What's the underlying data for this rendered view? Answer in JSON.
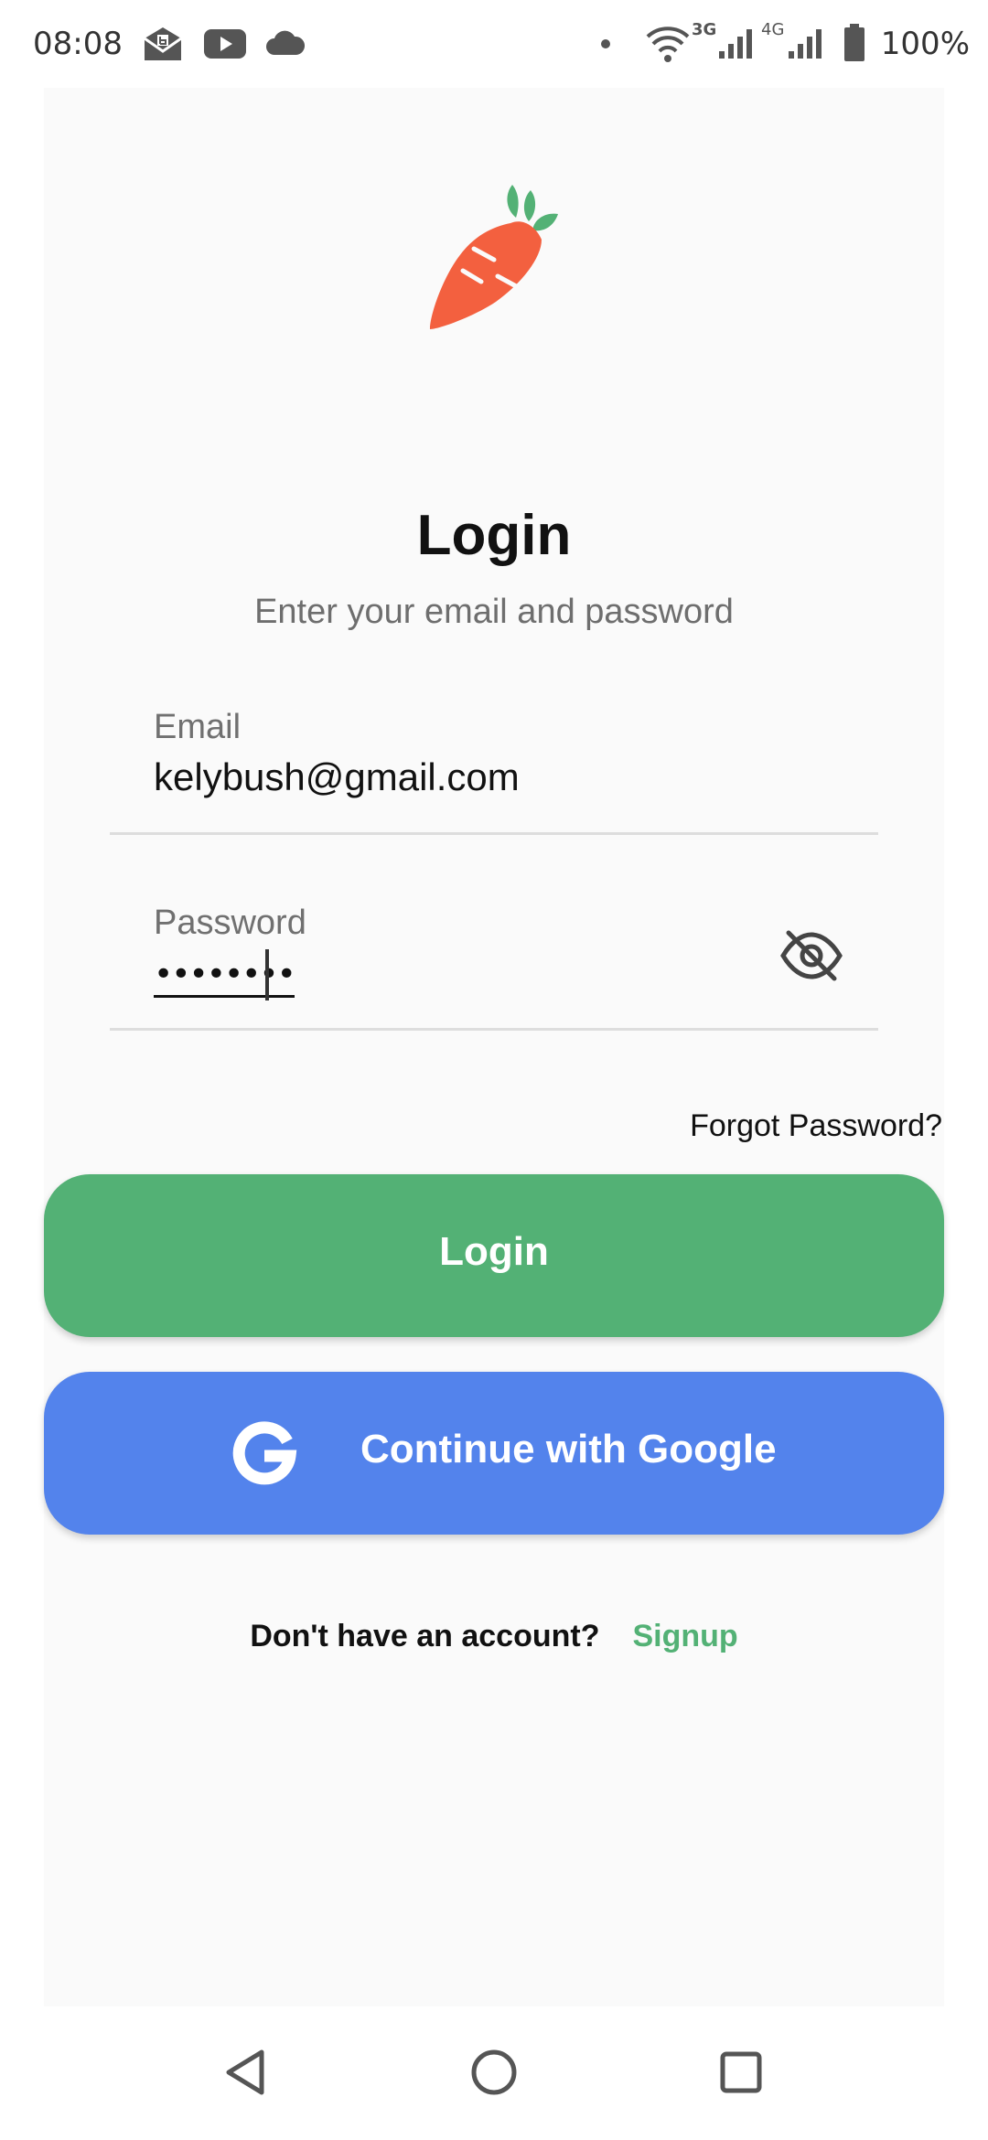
{
  "status_bar": {
    "time": "08:08",
    "battery": "100%",
    "icons": [
      "mail-icon",
      "youtube-icon",
      "cloud-icon",
      "dot-icon",
      "wifi-icon",
      "signal-3g-icon",
      "signal-4g-icon",
      "battery-icon"
    ],
    "network_3g": "3G",
    "network_4g": "4G"
  },
  "app": {
    "logo": "carrot-logo",
    "title": "Login",
    "subtitle": "Enter your email and password"
  },
  "form": {
    "email": {
      "label": "Email",
      "value": "kelybush@gmail.com"
    },
    "password": {
      "label": "Password",
      "value": "••••••••",
      "toggle_icon": "eye-off-icon"
    },
    "forgot_password": "Forgot Password?"
  },
  "buttons": {
    "login": "Login",
    "google": "Continue with Google",
    "google_icon": "google-g-icon"
  },
  "signup": {
    "prompt": "Don't have an account?",
    "link": "Signup"
  },
  "nav": {
    "back": "back-triangle-icon",
    "home": "home-circle-icon",
    "recents": "recents-square-icon"
  },
  "colors": {
    "accent_green": "#53b175",
    "google_blue": "#5383ec",
    "carrot_orange": "#f3603f",
    "leaf_green": "#53b175"
  }
}
